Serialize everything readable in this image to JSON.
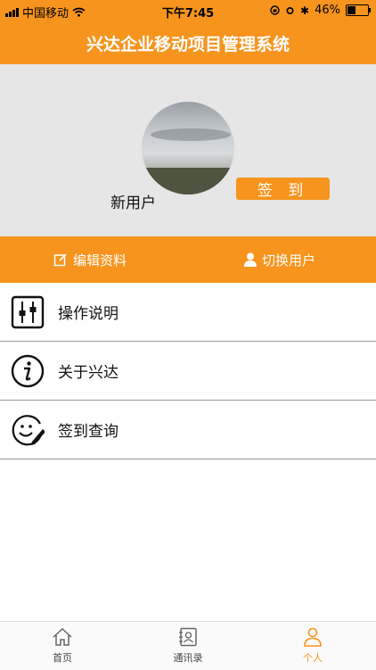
{
  "status": {
    "carrier": "中国移动",
    "time": "下午7:45",
    "battery": "46%",
    "battery_level": 0.46
  },
  "header": {
    "title": "兴达企业移动项目管理系统"
  },
  "profile": {
    "username": "新用户",
    "checkin_label": "签 到"
  },
  "actions": {
    "edit_label": "编辑资料",
    "switch_label": "切换用户"
  },
  "menu": {
    "items": [
      {
        "label": "操作说明",
        "icon": "sliders-icon"
      },
      {
        "label": "关于兴达",
        "icon": "info-icon"
      },
      {
        "label": "签到查询",
        "icon": "smiley-pen-icon"
      }
    ]
  },
  "tabs": [
    {
      "label": "首页",
      "icon": "home-icon"
    },
    {
      "label": "通讯录",
      "icon": "contacts-icon"
    },
    {
      "label": "个人",
      "icon": "person-icon",
      "active": true
    }
  ],
  "colors": {
    "accent": "#f7941d",
    "profile_bg": "#e6e6e6"
  }
}
